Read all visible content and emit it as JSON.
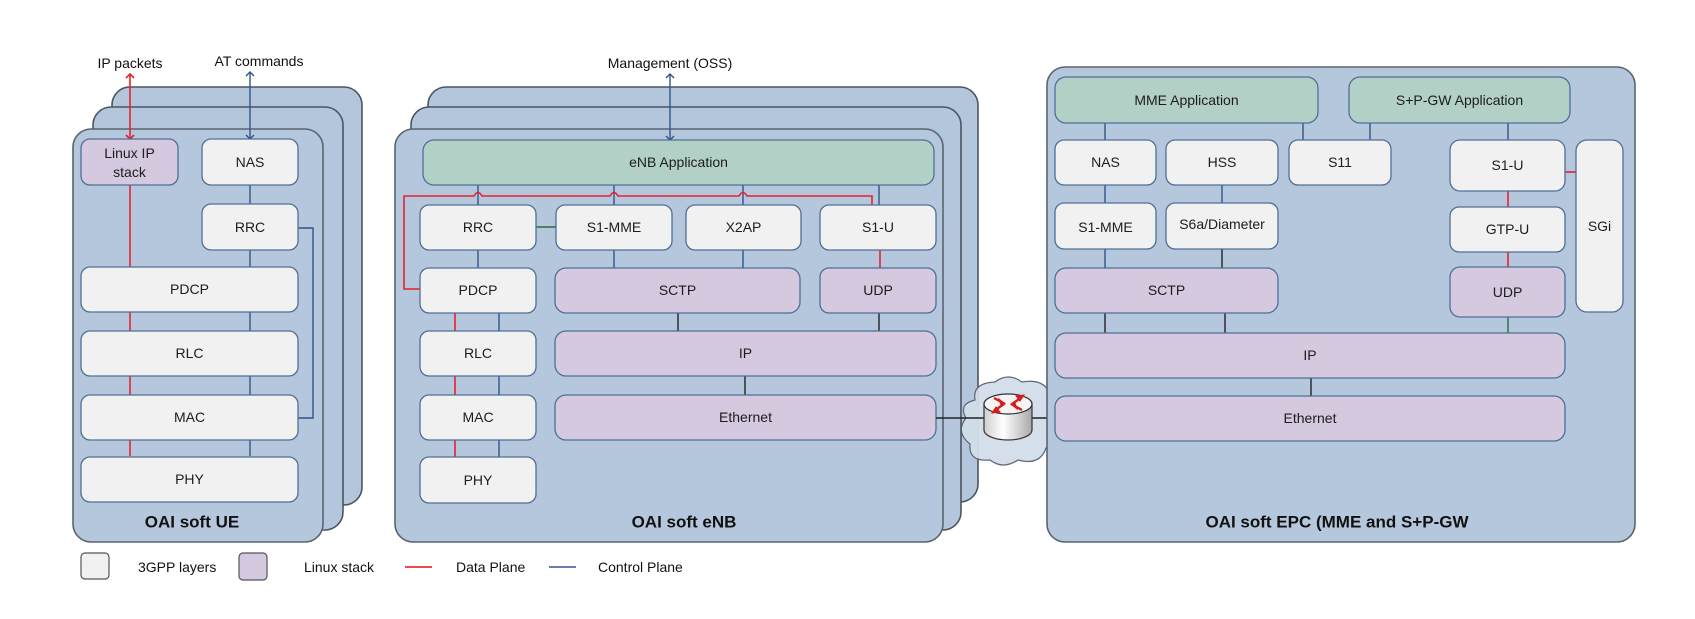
{
  "ue": {
    "title": "OAI soft UE",
    "ext_ip": "IP packets",
    "ext_at": "AT commands",
    "layers": {
      "linux_ip": [
        "Linux IP",
        "stack"
      ],
      "nas": "NAS",
      "rrc": "RRC",
      "pdcp": "PDCP",
      "rlc": "RLC",
      "mac": "MAC",
      "phy": "PHY"
    }
  },
  "enb": {
    "title": "OAI soft eNB",
    "ext_mgmt": "Management (OSS)",
    "app": "eNB Application",
    "layers": {
      "rrc": "RRC",
      "s1mme": "S1-MME",
      "x2ap": "X2AP",
      "s1u": "S1-U",
      "pdcp": "PDCP",
      "sctp": "SCTP",
      "udp": "UDP",
      "rlc": "RLC",
      "ip": "IP",
      "mac": "MAC",
      "ethernet": "Ethernet",
      "phy": "PHY"
    }
  },
  "epc": {
    "title": "OAI soft EPC (MME and S+P-GW",
    "mme_app": "MME Application",
    "spgw_app": "S+P-GW Application",
    "layers": {
      "nas": "NAS",
      "hss": "HSS",
      "s11": "S11",
      "s1u": "S1-U",
      "sgi": "SGi",
      "s1mme": "S1-MME",
      "s6a": "S6a/Diameter",
      "gtpu": "GTP-U",
      "sctp": "SCTP",
      "udp": "UDP",
      "ip": "IP",
      "ethernet": "Ethernet"
    }
  },
  "network": {
    "icon": "router-icon"
  },
  "legend": {
    "gpp": "3GPP layers",
    "linux": "Linux stack",
    "data_plane": "Data Plane",
    "control_plane": "Control Plane"
  },
  "colors": {
    "container": "#b5c7dd",
    "gpp_layer": "#f1f1f1",
    "linux_layer": "#d4c9de",
    "application": "#b3d0c7",
    "data_plane": "#e5222a",
    "control_plane": "#2f5588"
  }
}
